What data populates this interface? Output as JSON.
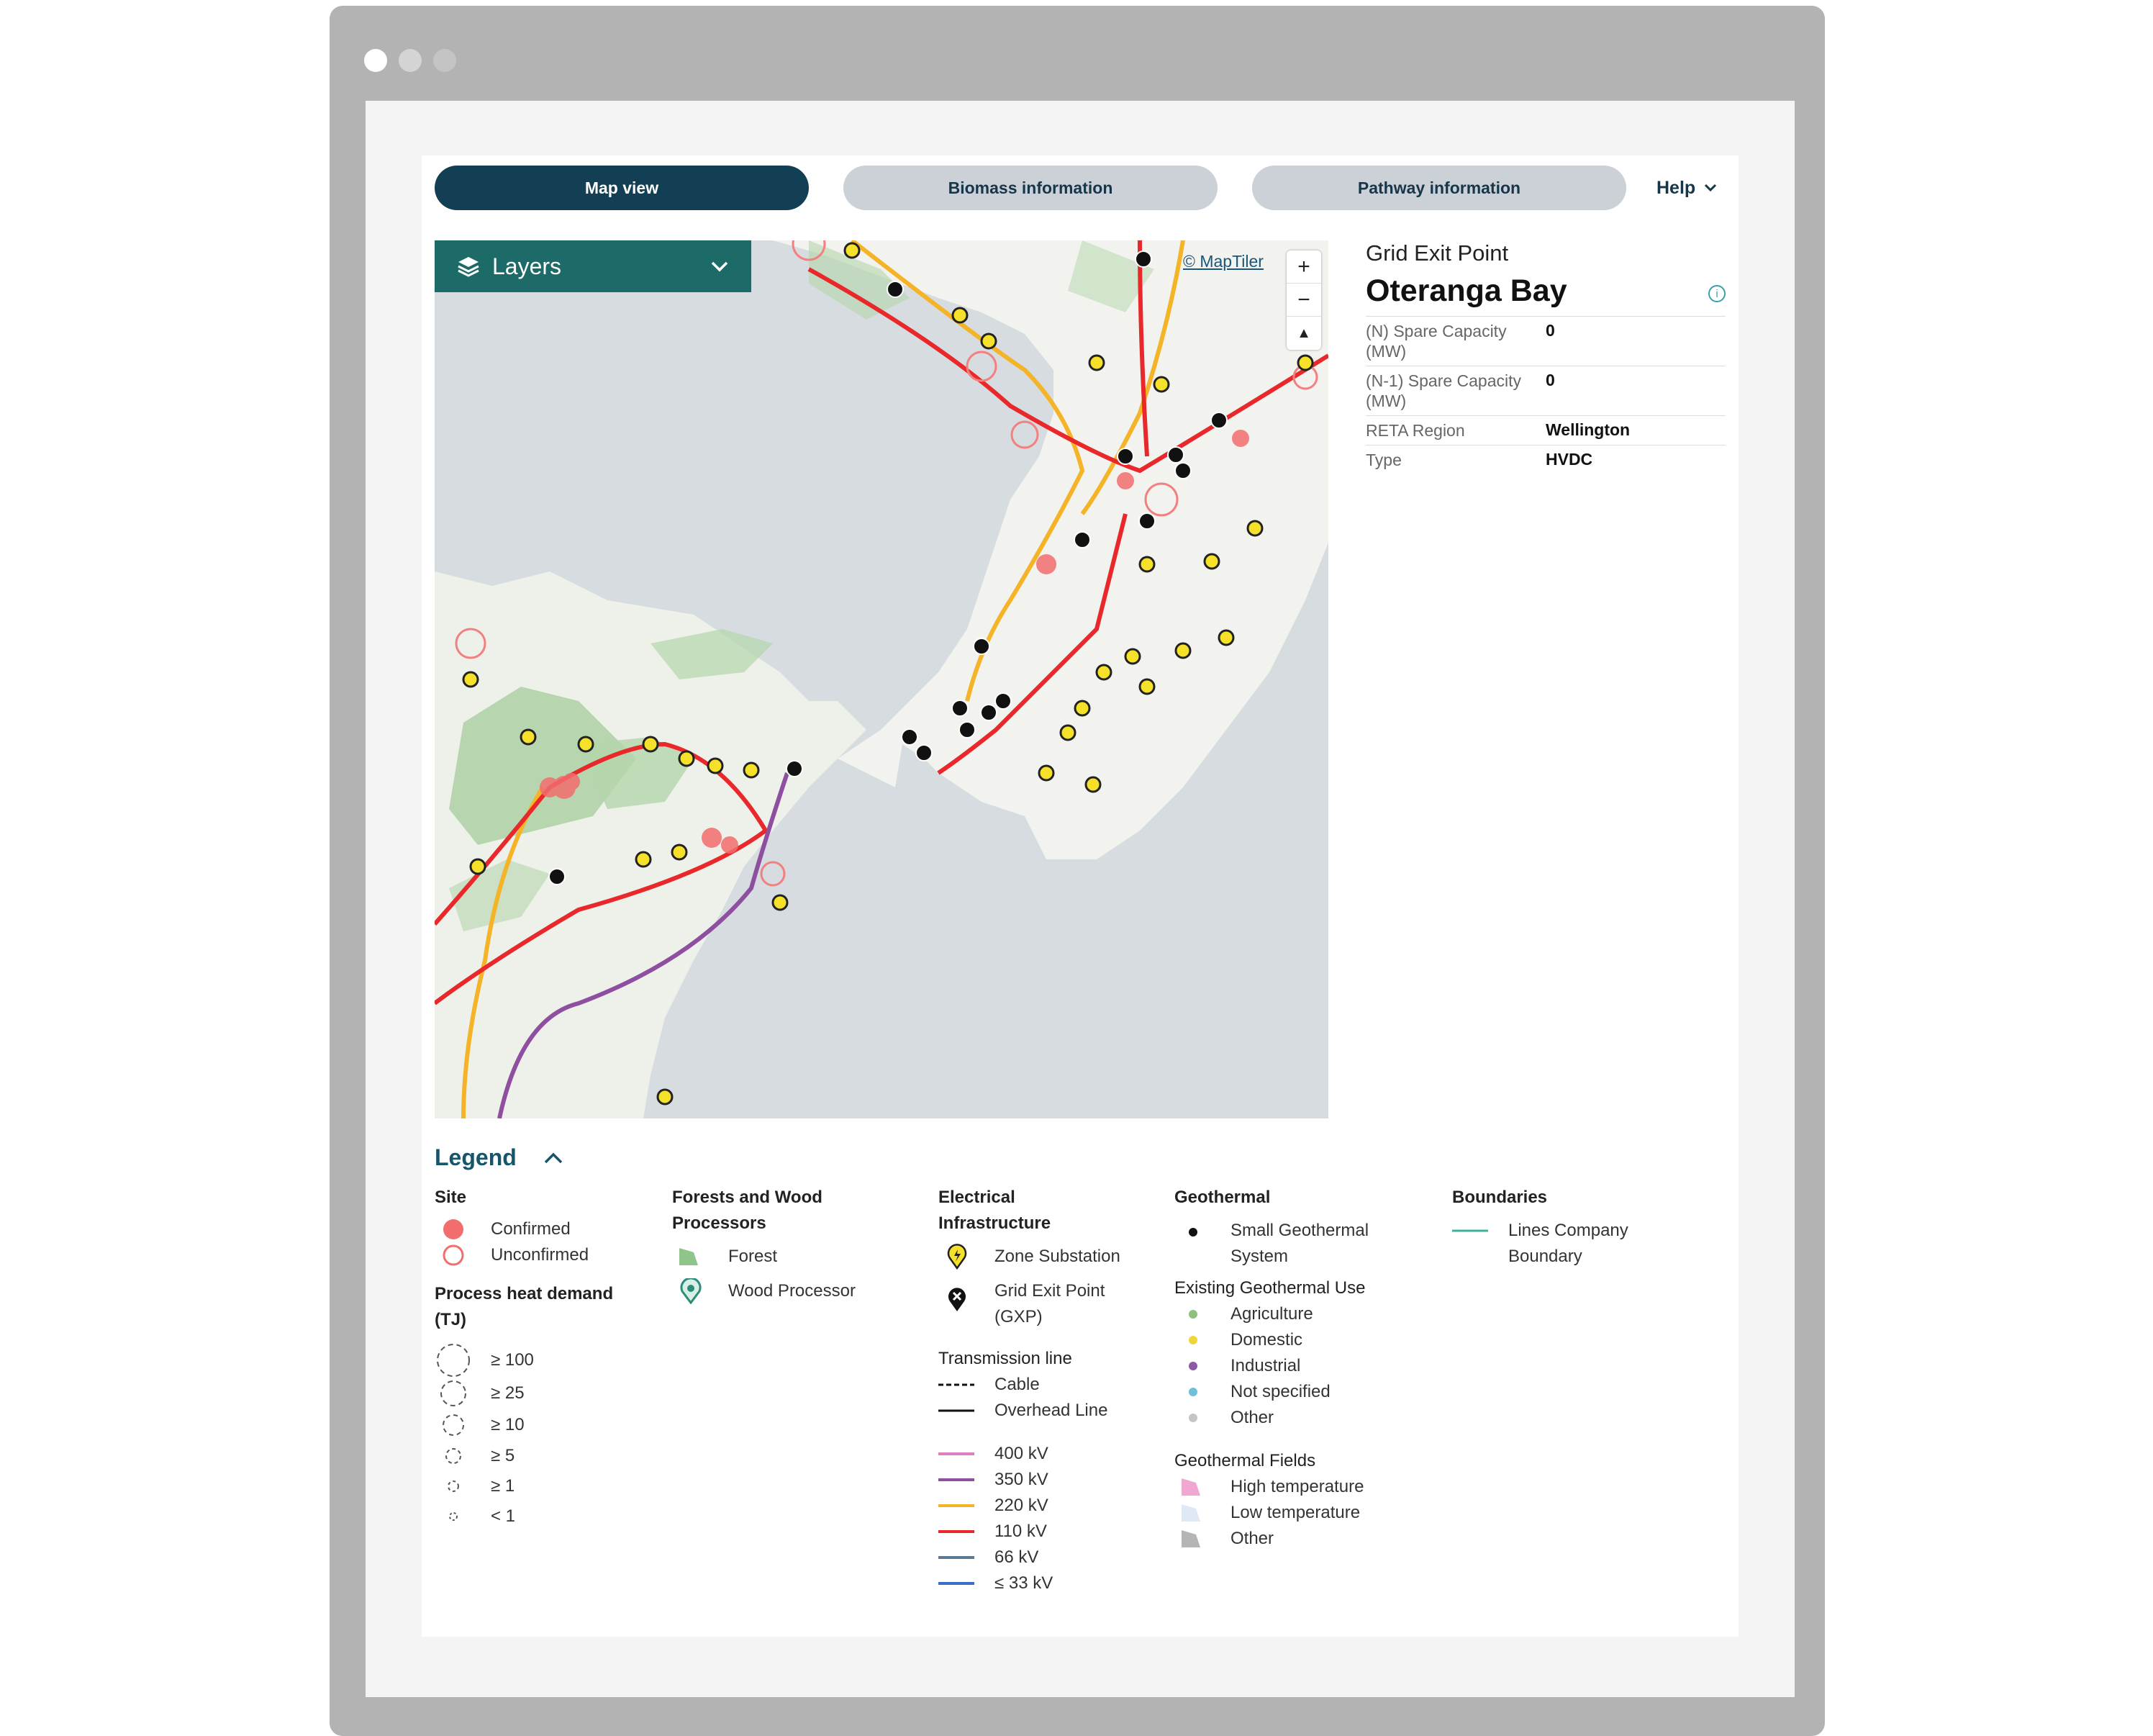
{
  "tabs": [
    {
      "label": "Map view",
      "active": true
    },
    {
      "label": "Biomass information",
      "active": false
    },
    {
      "label": "Pathway information",
      "active": false
    }
  ],
  "help_label": "Help",
  "map": {
    "layers_label": "Layers",
    "attribution": "© MapTiler",
    "zoom_in": "+",
    "zoom_out": "−",
    "compass": "▲"
  },
  "info": {
    "kicker": "Grid Exit Point",
    "title": "Oteranga Bay",
    "rows": [
      {
        "key": "(N) Spare Capacity (MW)",
        "value": "0"
      },
      {
        "key": "(N-1) Spare Capacity (MW)",
        "value": "0"
      },
      {
        "key": "RETA Region",
        "value": "Wellington"
      },
      {
        "key": "Type",
        "value": "HVDC"
      }
    ]
  },
  "legend": {
    "title": "Legend",
    "site": {
      "heading": "Site",
      "items": [
        "Confirmed",
        "Unconfirmed"
      ],
      "demand_heading": "Process heat demand (TJ)",
      "demand_items": [
        "≥ 100",
        "≥ 25",
        "≥ 10",
        "≥ 5",
        "≥ 1",
        "< 1"
      ]
    },
    "forests": {
      "heading": "Forests and Wood Processors",
      "items": [
        "Forest",
        "Wood Processor"
      ]
    },
    "electrical": {
      "heading": "Electrical Infrastructure",
      "items": [
        "Zone Substation",
        "Grid Exit Point (GXP)"
      ],
      "transmission_heading": "Transmission line",
      "line_types": [
        "Cable",
        "Overhead Line"
      ],
      "voltages": [
        {
          "label": "400 kV",
          "color": "#e07fc0"
        },
        {
          "label": "350 kV",
          "color": "#8e4fa0"
        },
        {
          "label": "220 kV",
          "color": "#f5b427"
        },
        {
          "label": "110 kV",
          "color": "#e8282b"
        },
        {
          "label": "66 kV",
          "color": "#5f7a95"
        },
        {
          "label": "≤ 33 kV",
          "color": "#3d6fc9"
        }
      ]
    },
    "geothermal": {
      "heading": "Geothermal",
      "small_system": "Small Geothermal System",
      "use_heading": "Existing Geothermal Use",
      "uses": [
        {
          "label": "Agriculture",
          "color": "#8cc27d"
        },
        {
          "label": "Domestic",
          "color": "#f0d53a"
        },
        {
          "label": "Industrial",
          "color": "#8e5aa6"
        },
        {
          "label": "Not specified",
          "color": "#6fc0d8"
        },
        {
          "label": "Other",
          "color": "#c4c4c4"
        }
      ],
      "fields_heading": "Geothermal Fields",
      "fields": [
        {
          "label": "High temperature",
          "color": "#f0a8d2"
        },
        {
          "label": "Low temperature",
          "color": "#dfe8f5"
        },
        {
          "label": "Other",
          "color": "#b5b5b5"
        }
      ]
    },
    "boundaries": {
      "heading": "Boundaries",
      "items": [
        "Lines Company Boundary"
      ]
    }
  }
}
